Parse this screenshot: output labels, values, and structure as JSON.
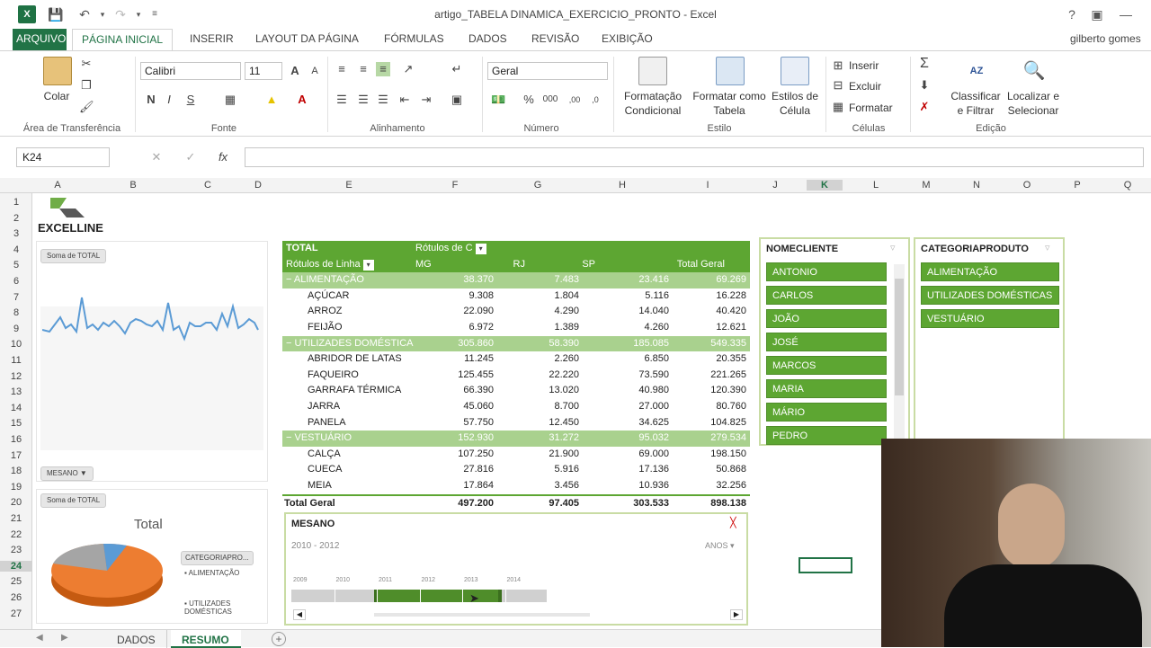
{
  "window": {
    "title": "artigo_TABELA DINAMICA_EXERCICIO_PRONTO - Excel",
    "app_icon": "X",
    "user": "gilberto gomes",
    "help": "?"
  },
  "tabs": [
    "ARQUIVO",
    "PÁGINA INICIAL",
    "INSERIR",
    "LAYOUT DA PÁGINA",
    "FÓRMULAS",
    "DADOS",
    "REVISÃO",
    "EXIBIÇÃO"
  ],
  "ribbon": {
    "paste_label": "Colar",
    "clipboard_label": "Área de Transferência",
    "font_label": "Fonte",
    "font_name": "Calibri",
    "font_size": "11",
    "bold": "N",
    "italic": "I",
    "underline": "S",
    "font_grow": "A",
    "font_shrink": "A",
    "font_color_glyph": "A",
    "align_label": "Alinhamento",
    "number_format": "Geral",
    "number_label": "Número",
    "percent": "%",
    "thousands": "000",
    "dec_inc": ",00",
    "dec_dec": ",0",
    "cond_format": [
      "Formatação",
      "Condicional"
    ],
    "format_table": [
      "Formatar como",
      "Tabela"
    ],
    "cell_styles": [
      "Estilos de",
      "Célula"
    ],
    "style_label": "Estilo",
    "insert": "Inserir",
    "delete": "Excluir",
    "format": "Formatar",
    "cells_label": "Células",
    "sort_filter": [
      "Classificar",
      "e Filtrar"
    ],
    "find_select": [
      "Localizar e",
      "Selecionar"
    ],
    "edit_label": "Edição",
    "sigma": "Σ",
    "sort_glyph": "AZ"
  },
  "formula_bar": {
    "name_box": "K24",
    "fx": "fx",
    "cancel": "✕",
    "enter": "✓"
  },
  "columns": [
    "A",
    "B",
    "C",
    "D",
    "E",
    "F",
    "G",
    "H",
    "I",
    "J",
    "K",
    "L",
    "M",
    "N",
    "O",
    "P",
    "Q"
  ],
  "rows": [
    "1",
    "2",
    "3",
    "4",
    "5",
    "6",
    "7",
    "8",
    "9",
    "10",
    "11",
    "12",
    "13",
    "14",
    "15",
    "16",
    "17",
    "18",
    "19",
    "20",
    "21",
    "22",
    "23",
    "24",
    "25",
    "26",
    "27"
  ],
  "logo_text": "EXCELLINE",
  "charts": {
    "line_field": "Soma de TOTAL",
    "line_filter": "MESANO",
    "pie_field": "Soma de TOTAL",
    "pie_title": "Total",
    "pie_legend_button": "CATEGORIAPRO...",
    "pie_legend": [
      "ALIMENTAÇÃO",
      "UTILIZADES DOMÉSTICAS"
    ]
  },
  "pivot": {
    "header_total": "TOTAL",
    "col_labels_title": "Rótulos de C",
    "row_labels_title": "Rótulos de Linha",
    "cols": [
      "MG",
      "RJ",
      "SP",
      "Total Geral"
    ],
    "rows": [
      {
        "type": "cat",
        "label": "ALIMENTAÇÃO",
        "vals": [
          "38.370",
          "7.483",
          "23.416",
          "69.269"
        ]
      },
      {
        "type": "item",
        "label": "AÇÚCAR",
        "vals": [
          "9.308",
          "1.804",
          "5.116",
          "16.228"
        ]
      },
      {
        "type": "item",
        "label": "ARROZ",
        "vals": [
          "22.090",
          "4.290",
          "14.040",
          "40.420"
        ]
      },
      {
        "type": "item",
        "label": "FEIJÃO",
        "vals": [
          "6.972",
          "1.389",
          "4.260",
          "12.621"
        ]
      },
      {
        "type": "cat",
        "label": "UTILIZADES DOMÉSTICA",
        "vals": [
          "305.860",
          "58.390",
          "185.085",
          "549.335"
        ]
      },
      {
        "type": "item",
        "label": "ABRIDOR DE LATAS",
        "vals": [
          "11.245",
          "2.260",
          "6.850",
          "20.355"
        ]
      },
      {
        "type": "item",
        "label": "FAQUEIRO",
        "vals": [
          "125.455",
          "22.220",
          "73.590",
          "221.265"
        ]
      },
      {
        "type": "item",
        "label": "GARRAFA TÉRMICA",
        "vals": [
          "66.390",
          "13.020",
          "40.980",
          "120.390"
        ]
      },
      {
        "type": "item",
        "label": "JARRA",
        "vals": [
          "45.060",
          "8.700",
          "27.000",
          "80.760"
        ]
      },
      {
        "type": "item",
        "label": "PANELA",
        "vals": [
          "57.750",
          "12.450",
          "34.625",
          "104.825"
        ]
      },
      {
        "type": "cat",
        "label": "VESTUÁRIO",
        "vals": [
          "152.930",
          "31.272",
          "95.032",
          "279.534"
        ]
      },
      {
        "type": "item",
        "label": "CALÇA",
        "vals": [
          "107.250",
          "21.900",
          "69.000",
          "198.150"
        ]
      },
      {
        "type": "item",
        "label": "CUECA",
        "vals": [
          "27.816",
          "5.916",
          "17.136",
          "50.868"
        ]
      },
      {
        "type": "item",
        "label": "MEIA",
        "vals": [
          "17.864",
          "3.456",
          "10.936",
          "32.256"
        ]
      },
      {
        "type": "total",
        "label": "Total Geral",
        "vals": [
          "497.200",
          "97.405",
          "303.533",
          "898.138"
        ]
      }
    ]
  },
  "timeline": {
    "title": "MESANO",
    "range": "2010 - 2012",
    "unit": "ANOS",
    "years": [
      "2009",
      "2010",
      "2011",
      "2012",
      "2013",
      "2014"
    ],
    "selected_from": 2010,
    "selected_to": 2012
  },
  "slicer_client": {
    "title": "NOMECLIENTE",
    "items": [
      "ANTONIO",
      "CARLOS",
      "JOÃO",
      "JOSÉ",
      "MARCOS",
      "MARIA",
      "MÁRIO",
      "PEDRO"
    ]
  },
  "slicer_category": {
    "title": "CATEGORIAPRODUTO",
    "items": [
      "ALIMENTAÇÃO",
      "UTILIZADES DOMÉSTICAS",
      "VESTUÁRIO"
    ]
  },
  "sheets": [
    "DADOS",
    "RESUMO"
  ],
  "active_sheet": "RESUMO",
  "colors": {
    "excel_green": "#217346",
    "slicer_green": "#5da632",
    "pivot_header": "#5da632",
    "pivot_cat": "#a9d18e"
  }
}
